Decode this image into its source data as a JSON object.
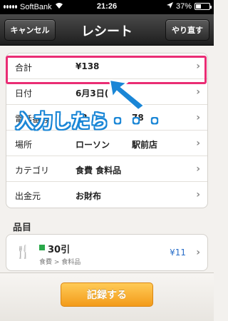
{
  "status_bar": {
    "carrier": "SoftBank",
    "time": "21:26",
    "battery": "37%",
    "battery_level": 0.37,
    "icons": [
      "signal-icon",
      "wifi-icon",
      "location-icon",
      "battery-icon"
    ]
  },
  "nav": {
    "cancel": "キャンセル",
    "title": "レシート",
    "redo": "やり直す"
  },
  "rows": [
    {
      "label": "合計",
      "value": "¥138",
      "value2": ""
    },
    {
      "label": "日付",
      "value": "6月3日(",
      "value2": ""
    },
    {
      "label": "電話番号",
      "value": "03",
      "value2": "78"
    },
    {
      "label": "場所",
      "value": "ローソン",
      "value2": "駅前店"
    },
    {
      "label": "カテゴリ",
      "value": "食費 食料品",
      "value2": ""
    },
    {
      "label": "出金元",
      "value": "お財布",
      "value2": ""
    }
  ],
  "items_section": {
    "title": "品目",
    "items": [
      {
        "name": "30引",
        "category": "食費 > 食料品",
        "price": "¥11"
      }
    ]
  },
  "bottom": {
    "record": "記録する"
  },
  "annotation": {
    "text": "入力したら・・・"
  },
  "colors": {
    "highlight": "#ea2d74",
    "annotation": "#1a86d6",
    "record_button": "#f39b1a",
    "price": "#2a6fc9"
  }
}
